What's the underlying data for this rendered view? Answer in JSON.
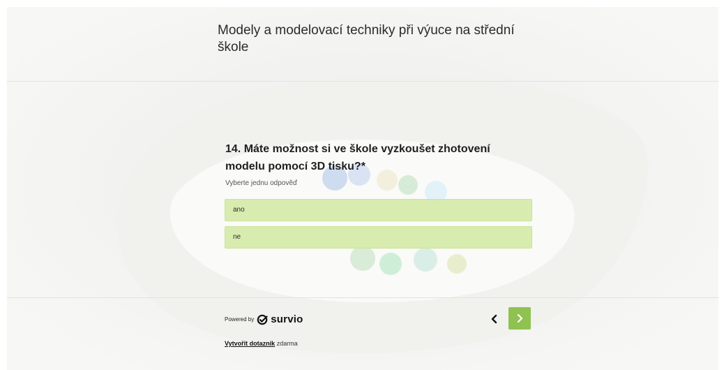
{
  "survey": {
    "title": "Modely a modelovací techniky při výuce na střední škole"
  },
  "question": {
    "title": "14. Máte možnost si ve škole vyzkoušet zhotovení modelu pomocí 3D tisku?*",
    "hint": "Vyberte jednu odpověď",
    "options": [
      {
        "label": "ano"
      },
      {
        "label": "ne"
      }
    ]
  },
  "footer": {
    "powered_by": "Powered by",
    "brand": "survio",
    "create_link_strong": "Vytvořit dotazník",
    "create_link_rest": " zdarma"
  },
  "navigation": {
    "prev_icon": "chevron-left-icon",
    "next_icon": "chevron-right-icon"
  },
  "colors": {
    "option_bg": "#d6eaa8",
    "next_button": "#8fc250",
    "brand_green": "#8fc250"
  }
}
